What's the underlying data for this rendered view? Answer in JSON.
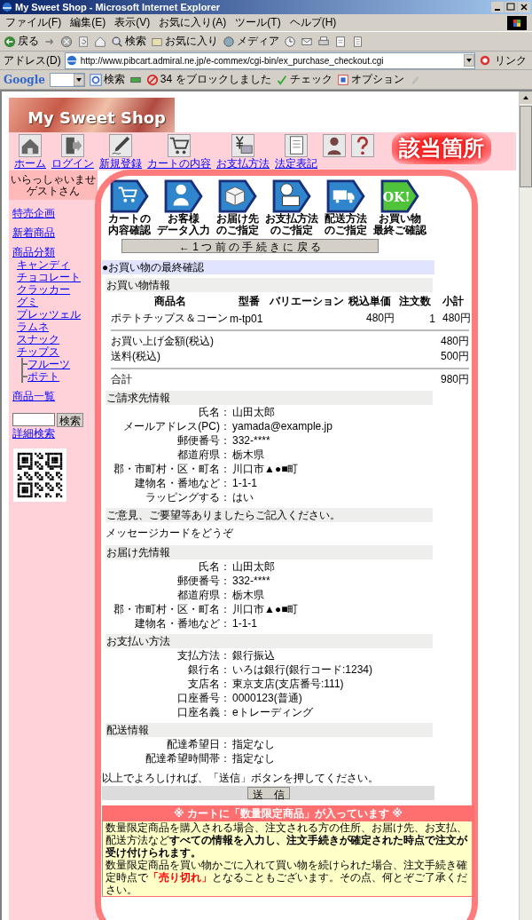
{
  "browser": {
    "title": "My Sweet Shop - Microsoft Internet Explorer",
    "menu": [
      "ファイル(F)",
      "編集(E)",
      "表示(V)",
      "お気に入り(A)",
      "ツール(T)",
      "ヘルプ(H)"
    ],
    "toolbar": [
      {
        "kind": "back",
        "label": "戻る"
      },
      {
        "kind": "forward"
      },
      {
        "kind": "stop"
      },
      {
        "kind": "refresh"
      },
      {
        "kind": "home"
      },
      {
        "kind": "search",
        "label": "検索"
      },
      {
        "kind": "favorites",
        "label": "お気に入り"
      },
      {
        "kind": "media",
        "label": "メディア"
      },
      {
        "kind": "history"
      },
      {
        "kind": "mail"
      },
      {
        "kind": "print"
      },
      {
        "kind": "edit"
      },
      {
        "kind": "discuss"
      }
    ],
    "address_label": "アドレス(D)",
    "url": "http://www.pibcart.admiral.ne.jp/e-commex/cgi-bin/ex_purchase_checkout.cgi",
    "links": "リンク",
    "google": {
      "logo": "Google",
      "search": "検索",
      "blocked": "34 をブロックしました",
      "check": "チェック",
      "options": "オプション"
    }
  },
  "site": {
    "logo": "My Sweet Shop",
    "nav": [
      {
        "kind": "house",
        "label": "ホーム"
      },
      {
        "kind": "door",
        "label": "ログイン"
      },
      {
        "kind": "pen",
        "label": "新規登録"
      },
      {
        "kind": "cart",
        "label": "カートの内容"
      },
      {
        "kind": "yen",
        "label": "お支払方法"
      },
      {
        "kind": "document",
        "label": "法定表記"
      },
      {
        "kind": "person"
      },
      {
        "kind": "question"
      }
    ]
  },
  "annotation": "該当箇所",
  "sidebar": {
    "greeting": [
      "いらっしゃいませ",
      "ゲストさん"
    ],
    "links": [
      {
        "label": "特売企画"
      },
      {
        "label": "新着商品"
      },
      {
        "label": "商品分類",
        "children": [
          {
            "label": "キャンディ"
          },
          {
            "label": "チョコレート"
          },
          {
            "label": "クラッカー"
          },
          {
            "label": "グミ"
          },
          {
            "label": "プレッツェル"
          },
          {
            "label": "ラムネ"
          },
          {
            "label": "スナック"
          },
          {
            "label": "チップス",
            "children": [
              {
                "label": "フルーツ"
              },
              {
                "label": "ポテト"
              }
            ]
          }
        ]
      },
      {
        "label": "商品一覧"
      }
    ],
    "search_button": "検索",
    "advanced_search": "詳細検索"
  },
  "steps": [
    {
      "kind": "cart",
      "label": [
        "カートの",
        "内容確認"
      ],
      "selected": false
    },
    {
      "kind": "person",
      "label": [
        "お客様",
        "データ入力"
      ],
      "selected": false
    },
    {
      "kind": "box",
      "label": [
        "お届け先",
        "のご指定"
      ],
      "selected": false
    },
    {
      "kind": "card",
      "label": [
        "お支払方法",
        "のご指定"
      ],
      "selected": false
    },
    {
      "kind": "truck",
      "label": [
        "配送方法",
        "のご指定"
      ],
      "selected": false
    },
    {
      "kind": "ok",
      "badge": "OK!",
      "label": [
        "お買い物",
        "最終ご確認"
      ],
      "selected": true
    }
  ],
  "back_button": "← 1 つ 前 の 手 続 き に 戻 る",
  "page_heading": "●お買い物の最終確認",
  "order": {
    "title": "お買い物情報",
    "columns": [
      "商品名",
      "型番",
      "バリエーション",
      "税込単価",
      "注文数",
      "小計"
    ],
    "rows": [
      {
        "name": "ポテトチップス＆コーン",
        "model": "m-tp01",
        "price": "480円",
        "qty": "1",
        "subtotal": "480円"
      }
    ],
    "summary": [
      {
        "label": "お買い上げ金額(税込)",
        "value": "480円"
      },
      {
        "label": "送料(税込)",
        "value": "500円"
      }
    ],
    "total": {
      "label": "合計",
      "value": "980円"
    }
  },
  "sections": [
    {
      "kind": "fields",
      "title": "ご請求先情報",
      "fields": [
        {
          "label": "氏名：",
          "value": "山田太郎"
        },
        {
          "label": "メールアドレス(PC)：",
          "value": "yamada@example.jp"
        },
        {
          "label": "郵便番号：",
          "value": "332-****"
        },
        {
          "label": "都道府県：",
          "value": "栃木県"
        },
        {
          "label": "郡・市町村・区・町名：",
          "value": "川口市▲●■町"
        },
        {
          "label": "建物名・番地など：",
          "value": "1-1-1"
        },
        {
          "label": "ラッピングする：",
          "value": "はい"
        }
      ]
    },
    {
      "kind": "note",
      "title": "ご意見、ご要望等ありましたらご記入ください。",
      "text": "メッセージカードをどうぞ"
    },
    {
      "kind": "fields",
      "title": "お届け先情報",
      "fields": [
        {
          "label": "氏名：",
          "value": "山田太郎"
        },
        {
          "label": "郵便番号：",
          "value": "332-****"
        },
        {
          "label": "都道府県：",
          "value": "栃木県"
        },
        {
          "label": "郡・市町村・区・町名：",
          "value": "川口市▲●■町"
        },
        {
          "label": "建物名・番地など：",
          "value": "1-1-1"
        }
      ]
    },
    {
      "kind": "fields",
      "title": "お支払い方法",
      "fields": [
        {
          "label": "支払方法：",
          "value": "銀行振込"
        },
        {
          "label": "銀行名：",
          "value": "いろは銀行(銀行コード:1234)"
        },
        {
          "label": "支店名：",
          "value": "東京支店(支店番号:111)"
        },
        {
          "label": "口座番号：",
          "value": "0000123(普通)"
        },
        {
          "label": "口座名義：",
          "value": "eトレーディング"
        }
      ]
    },
    {
      "kind": "fields",
      "title": "配送情報",
      "fields": [
        {
          "label": "配達希望日：",
          "value": "指定なし"
        },
        {
          "label": "配達希望時間帯：",
          "value": "指定なし"
        }
      ]
    }
  ],
  "confirm": {
    "text": "以上でよろしければ、「送信」ボタンを押してください。",
    "submit": "送　信"
  },
  "notice": {
    "title": "※ カートに「数量限定商品」が入っています ※",
    "paragraphs": [
      [
        {
          "kind": "plain",
          "text": "数量限定商品を購入される場合、注文される方の住所、お届け先、お支払、配送方法など"
        },
        {
          "kind": "bold",
          "text": "すべての情報を入力し、注文手続きが確定された時点で注文が受け付けられます。"
        }
      ],
      [
        {
          "kind": "plain",
          "text": "数量限定商品を買い物かごに入れて買い物を続けられた場合、注文手続き確定時点で"
        },
        {
          "kind": "alert",
          "text": "「売り切れ」"
        },
        {
          "kind": "plain",
          "text": "となることもございます。その点、何とぞご了承ください。"
        }
      ]
    ]
  }
}
